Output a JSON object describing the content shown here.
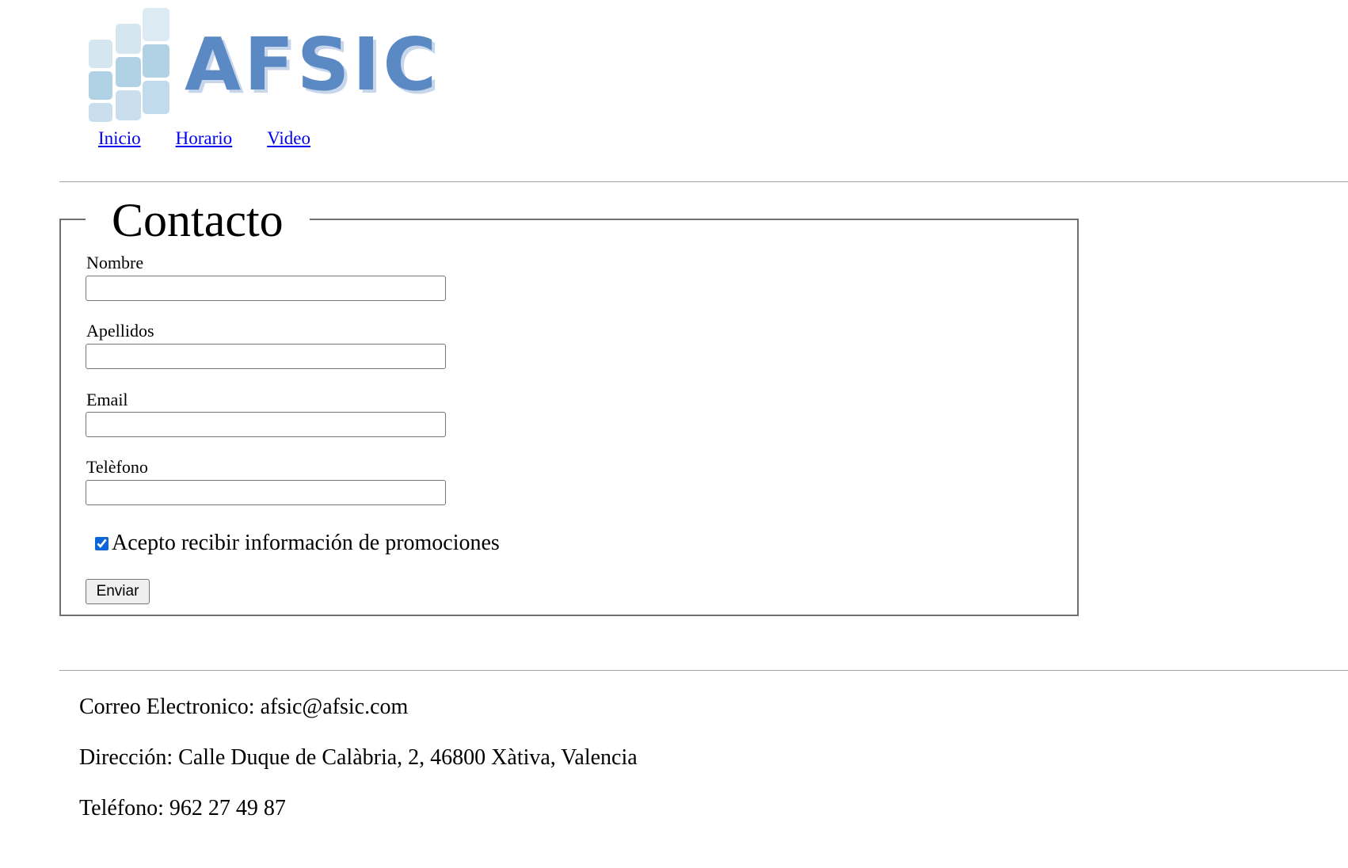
{
  "header": {
    "logo_text": "AFSIC",
    "nav": [
      {
        "label": "Inicio"
      },
      {
        "label": "Horario"
      },
      {
        "label": "Video"
      }
    ]
  },
  "form": {
    "legend": "Contacto",
    "fields": [
      {
        "label": "Nombre",
        "value": ""
      },
      {
        "label": "Apellidos",
        "value": ""
      },
      {
        "label": "Email",
        "value": ""
      },
      {
        "label": "Telèfono",
        "value": ""
      }
    ],
    "checkbox": {
      "label": "Acepto recibir información de promociones",
      "checked": true
    },
    "submit_label": "Enviar"
  },
  "footer": {
    "email_line": "Correo Electronico: afsic@afsic.com",
    "address_line": "Dirección: Calle Duque de Calàbria, 2, 46800 Xàtiva, Valencia",
    "phone_line": "Teléfono: 962 27 49 87"
  },
  "colors": {
    "link": "#0000ee",
    "logo_blue": "#5b89c4",
    "logo_tiles": "#a9cde3",
    "checkbox_accent": "#0a66d8"
  }
}
